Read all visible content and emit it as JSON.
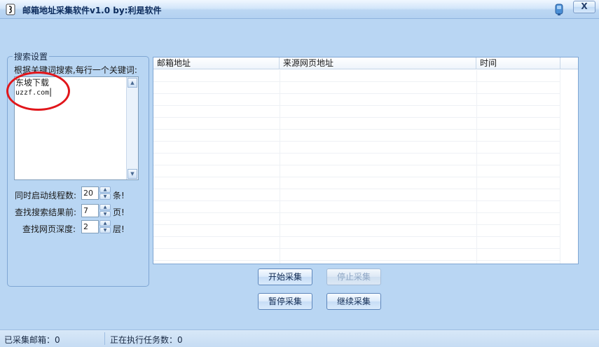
{
  "window": {
    "title": "邮箱地址采集软件v1.0  by:利是软件",
    "close_label": "X"
  },
  "search_settings": {
    "legend": "搜索设置",
    "keywords_label": "根据关键词搜索,每行一个关键词:",
    "keywords": [
      "东坡下载",
      "uzzf.com"
    ],
    "threads_label": "同时启动线程数:",
    "threads_value": "20",
    "threads_unit": "条!",
    "results_label": "查找搜索结果前:",
    "results_value": "7",
    "results_unit": "页!",
    "depth_label": "查找网页深度:",
    "depth_value": "2",
    "depth_unit": "层!"
  },
  "table": {
    "columns": [
      "邮箱地址",
      "来源网页地址",
      "时间"
    ],
    "rows": []
  },
  "buttons": {
    "start": "开始采集",
    "stop": "停止采集",
    "pause": "暂停采集",
    "resume": "继续采集"
  },
  "status": {
    "collected": "已采集邮箱：0",
    "running": "正在执行任务数：0"
  },
  "colors": {
    "annotation_circle": "#e1161b",
    "window_bg": "#b9d6f3"
  }
}
